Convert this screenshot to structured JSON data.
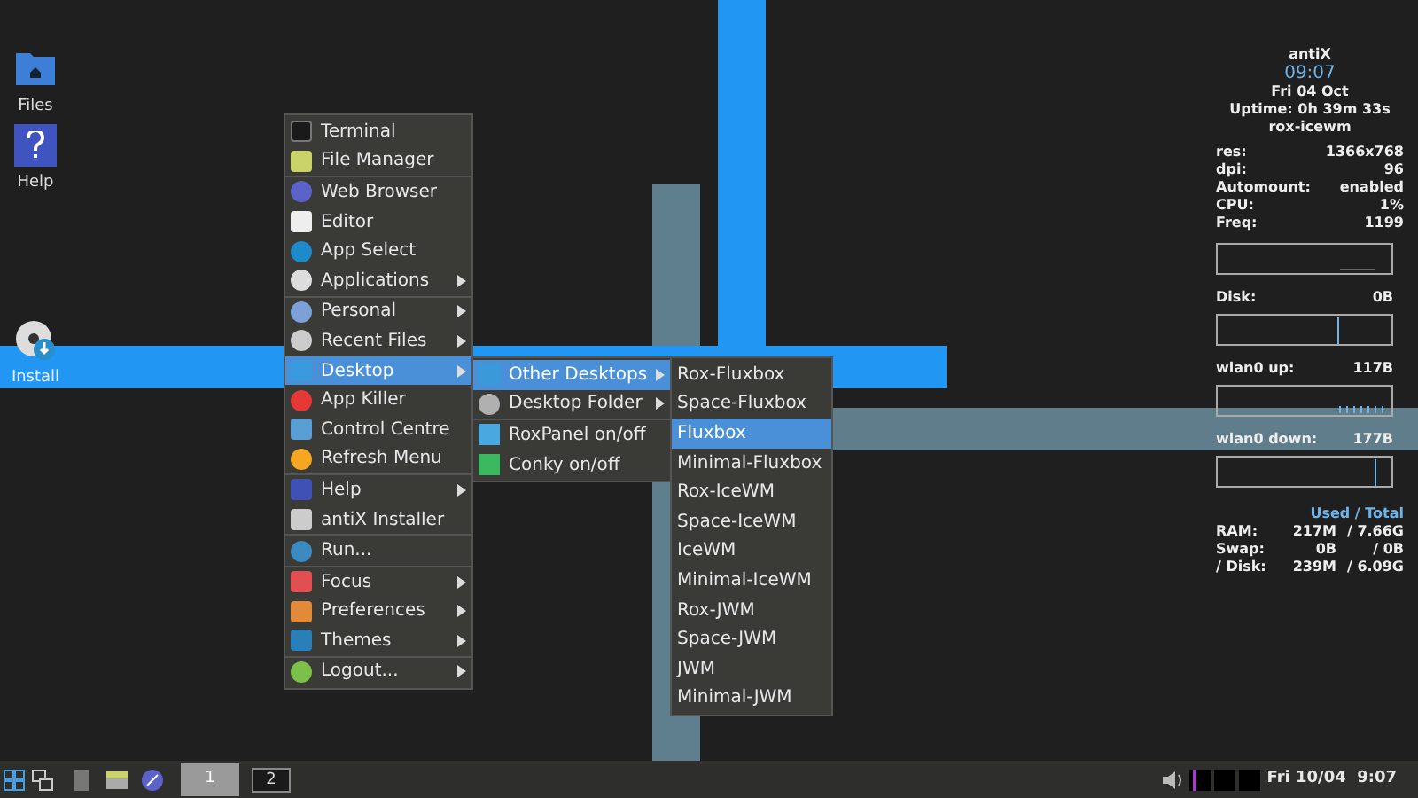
{
  "desktop_icons": [
    {
      "label": "Files"
    },
    {
      "label": "Help"
    },
    {
      "label": "Install"
    }
  ],
  "menu": {
    "groups": [
      [
        {
          "label": "Terminal",
          "submenu": false,
          "selected": false
        },
        {
          "label": "File Manager",
          "submenu": false,
          "selected": false
        }
      ],
      [
        {
          "label": "Web Browser",
          "submenu": false,
          "selected": false
        },
        {
          "label": "Editor",
          "submenu": false,
          "selected": false
        },
        {
          "label": "App Select",
          "submenu": false,
          "selected": false
        },
        {
          "label": "Applications",
          "submenu": true,
          "selected": false
        }
      ],
      [
        {
          "label": "Personal",
          "submenu": true,
          "selected": false
        },
        {
          "label": "Recent Files",
          "submenu": true,
          "selected": false
        },
        {
          "label": "Desktop",
          "submenu": true,
          "selected": true
        },
        {
          "label": "App Killer",
          "submenu": false,
          "selected": false
        },
        {
          "label": "Control Centre",
          "submenu": false,
          "selected": false
        },
        {
          "label": "Refresh Menu",
          "submenu": false,
          "selected": false
        }
      ],
      [
        {
          "label": "Help",
          "submenu": true,
          "selected": false
        },
        {
          "label": "antiX Installer",
          "submenu": false,
          "selected": false
        }
      ],
      [
        {
          "label": "Run...",
          "submenu": false,
          "selected": false
        }
      ],
      [
        {
          "label": "Focus",
          "submenu": true,
          "selected": false
        },
        {
          "label": "Preferences",
          "submenu": true,
          "selected": false
        },
        {
          "label": "Themes",
          "submenu": true,
          "selected": false
        }
      ],
      [
        {
          "label": "Logout...",
          "submenu": true,
          "selected": false
        }
      ]
    ]
  },
  "desktop_submenu": {
    "items": [
      {
        "label": "Other Desktops",
        "submenu": true,
        "selected": true
      },
      {
        "label": "Desktop Folder",
        "submenu": true,
        "selected": false
      },
      {
        "label": "RoxPanel on/off",
        "submenu": false,
        "selected": false
      },
      {
        "label": "Conky on/off",
        "submenu": false,
        "selected": false
      }
    ]
  },
  "other_desktops_submenu": {
    "items": [
      {
        "label": "Rox-Fluxbox",
        "selected": false
      },
      {
        "label": "Space-Fluxbox",
        "selected": false
      },
      {
        "label": "Fluxbox",
        "selected": true
      },
      {
        "label": "Minimal-Fluxbox",
        "selected": false
      },
      {
        "label": "Rox-IceWM",
        "selected": false
      },
      {
        "label": "Space-IceWM",
        "selected": false
      },
      {
        "label": "IceWM",
        "selected": false
      },
      {
        "label": "Minimal-IceWM",
        "selected": false
      },
      {
        "label": "Rox-JWM",
        "selected": false
      },
      {
        "label": "Space-JWM",
        "selected": false
      },
      {
        "label": "JWM",
        "selected": false
      },
      {
        "label": "Minimal-JWM",
        "selected": false
      }
    ]
  },
  "conky": {
    "hostname": "antiX",
    "time": "09:07",
    "date": "Fri 04 Oct",
    "uptime": "Uptime: 0h 39m 33s",
    "session": "rox-icewm",
    "stats": [
      {
        "label": "res:",
        "value": "1366x768"
      },
      {
        "label": "dpi:",
        "value": "96"
      },
      {
        "label": "Automount:",
        "value": "enabled"
      },
      {
        "label": "CPU:",
        "value": "1%"
      },
      {
        "label": "Freq:",
        "value": "1199"
      }
    ],
    "graphs": [
      {
        "label": "Disk:",
        "value": "0B"
      },
      {
        "label": "wlan0 up:",
        "value": "117B"
      },
      {
        "label": "wlan0 down:",
        "value": "177B"
      }
    ],
    "memory_header": "Used / Total",
    "memory": [
      {
        "label": "RAM:",
        "used": "217M",
        "total": "/ 7.66G"
      },
      {
        "label": "Swap:",
        "used": "0B",
        "total": "/ 0B"
      },
      {
        "label": "/ Disk:",
        "used": "239M",
        "total": "/ 6.09G"
      }
    ]
  },
  "taskbar": {
    "workspaces": [
      {
        "label": "1",
        "selected": true
      },
      {
        "label": "2",
        "selected": false
      }
    ],
    "clock": "Fri 10/04  9:07"
  }
}
